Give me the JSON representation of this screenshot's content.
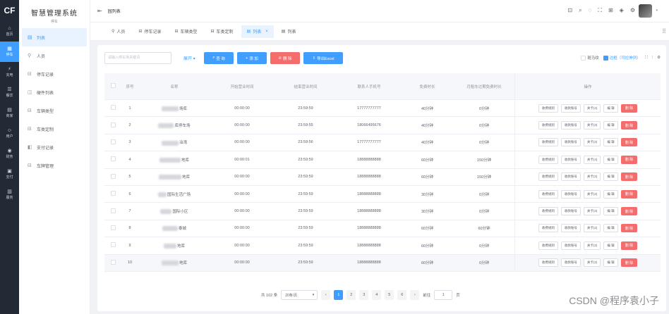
{
  "rail": {
    "logo": "CF",
    "items": [
      {
        "icon": "home-icon",
        "glyph": "⌂",
        "label": "首页"
      },
      {
        "icon": "parking-icon",
        "glyph": "▦",
        "label": "停车"
      },
      {
        "icon": "charging-icon",
        "glyph": "⚡",
        "label": "充电"
      },
      {
        "icon": "meal-icon",
        "glyph": "☰",
        "label": "餐饮"
      },
      {
        "icon": "shop-icon",
        "glyph": "▤",
        "label": "商家"
      },
      {
        "icon": "user-icon",
        "glyph": "☺",
        "label": "用户"
      },
      {
        "icon": "finance-icon",
        "glyph": "◉",
        "label": "财务"
      },
      {
        "icon": "ticket-icon",
        "glyph": "▣",
        "label": "支付"
      },
      {
        "icon": "service-icon",
        "glyph": "▥",
        "label": "服务"
      }
    ]
  },
  "sidebar": {
    "title": "智慧管理系统",
    "subtitle": "停车",
    "items": [
      {
        "icon": "list-icon",
        "glyph": "▤",
        "label": "列表"
      },
      {
        "icon": "person-icon",
        "glyph": "⚲",
        "label": "人员"
      },
      {
        "icon": "car-record-icon",
        "glyph": "⊟",
        "label": "停车记录"
      },
      {
        "icon": "hardware-icon",
        "glyph": "◫",
        "label": "硬件列表"
      },
      {
        "icon": "car-type-icon",
        "glyph": "⊟",
        "label": "车辆类型"
      },
      {
        "icon": "custom-icon",
        "glyph": "⊟",
        "label": "车类定制"
      },
      {
        "icon": "pay-record-icon",
        "glyph": "◧",
        "label": "支付记录"
      },
      {
        "icon": "car-manage-icon",
        "glyph": "⊟",
        "label": "车牌管理"
      }
    ]
  },
  "header": {
    "breadcrumb": "园列表",
    "icons": [
      "lock-icon",
      "search-icon",
      "bell-icon",
      "fullscreen-icon",
      "expand-icon",
      "skin-icon",
      "gear-icon"
    ]
  },
  "tabs": [
    {
      "icon": "person-icon",
      "label": "人员"
    },
    {
      "icon": "car-icon",
      "label": "停车记录"
    },
    {
      "icon": "car-icon",
      "label": "车辆类型"
    },
    {
      "icon": "car-icon",
      "label": "车类定制"
    },
    {
      "icon": "list-icon",
      "label": "列表"
    },
    {
      "icon": "list-icon",
      "label": "列表"
    }
  ],
  "toolbar": {
    "search_placeholder": "请输入停车场关键词",
    "expand_label": "展开 ▾",
    "query_label": "查 询",
    "add_label": "添 加",
    "delete_label": "删 除",
    "export_label": "导出Excel",
    "zebra_label": "斑马纹",
    "border_label": "边框（可拉伸列）"
  },
  "table": {
    "headers": {
      "no": "序号",
      "name": "名称",
      "open": "开始营业时间",
      "close": "结束营业时间",
      "phone": "联系人手机号",
      "free": "免费时长",
      "overfree": "月租车过期免费时长",
      "op": "操作"
    },
    "op_buttons": {
      "collect": "收费规则",
      "car_no": "收款账号",
      "gate": "关卡",
      "edit": "编 辑",
      "delete": "删 除"
    },
    "rows": [
      {
        "no": "1",
        "name_suffix": "场库",
        "blur_w": 24,
        "open": "00:00:00",
        "close": "23:59:59",
        "phone": "17777777777",
        "free": "40分钟",
        "overfree": "0分钟",
        "gate": "关卡(4)"
      },
      {
        "no": "2",
        "name_suffix": "库停车场",
        "blur_w": 22,
        "open": "00:00:00",
        "close": "23:59:55",
        "phone": "18066495676",
        "free": "40分钟",
        "overfree": "0分钟",
        "gate": "关卡(3)"
      },
      {
        "no": "3",
        "name_suffix": "泊湾",
        "blur_w": 24,
        "open": "00:00:00",
        "close": "23:59:56",
        "phone": "17777777777",
        "free": "40分钟",
        "overfree": "0分钟",
        "gate": "关卡(2)"
      },
      {
        "no": "4",
        "name_suffix": "地库",
        "blur_w": 30,
        "open": "00:00:01",
        "close": "23:59:59",
        "phone": "18888888888",
        "free": "60分钟",
        "overfree": "150分钟",
        "gate": "关卡(4)"
      },
      {
        "no": "5",
        "name_suffix": "地库",
        "blur_w": 32,
        "open": "00:00:00",
        "close": "23:59:59",
        "phone": "18888888888",
        "free": "60分钟",
        "overfree": "150分钟",
        "gate": "关卡(3)"
      },
      {
        "no": "6",
        "name_suffix": "国际生活广场",
        "blur_w": 12,
        "open": "00:00:00",
        "close": "23:59:59",
        "phone": "18888888888",
        "free": "30分钟",
        "overfree": "0分钟",
        "gate": "关卡(2)"
      },
      {
        "no": "7",
        "name_suffix": "国际小区",
        "blur_w": 16,
        "open": "00:00:00",
        "close": "23:59:59",
        "phone": "18888888888",
        "free": "30分钟",
        "overfree": "0分钟",
        "gate": "关卡(3)"
      },
      {
        "no": "8",
        "name_suffix": "泰城",
        "blur_w": 22,
        "open": "00:00:00",
        "close": "23:59:59",
        "phone": "18888888888",
        "free": "60分钟",
        "overfree": "60分钟",
        "gate": "关卡(2)"
      },
      {
        "no": "9",
        "name_suffix": "地库",
        "blur_w": 18,
        "open": "00:00:00",
        "close": "23:59:59",
        "phone": "18888888888",
        "free": "60分钟",
        "overfree": "0分钟",
        "gate": "关卡(2)"
      },
      {
        "no": "10",
        "name_suffix": "地库",
        "blur_w": 24,
        "open": "00:00:00",
        "close": "23:59:59",
        "phone": "18888888888",
        "free": "60分钟",
        "overfree": "0分钟",
        "gate": "关卡(2)"
      }
    ]
  },
  "pagination": {
    "total": "共 102 条",
    "page_size": "20条/页",
    "pages": [
      "1",
      "2",
      "3",
      "4",
      "5",
      "6"
    ],
    "goto_label": "前往",
    "goto_value": "1",
    "page_unit": "页"
  },
  "watermark": "CSDN @程序袁小子",
  "colors": {
    "primary": "#409eff",
    "danger": "#f56c6c",
    "rail_bg": "#222a35"
  }
}
